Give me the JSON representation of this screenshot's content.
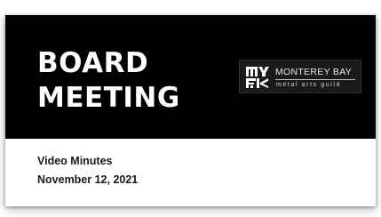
{
  "slide": {
    "title_line1": "BOARD",
    "title_line2": "MEETING",
    "subtitle_line1": "Video Minutes",
    "subtitle_line2": "November 12, 2021"
  },
  "logo": {
    "line1": "MONTEREY BAY",
    "line2": "metal arts guild",
    "icon": "mbmag-logo-icon"
  },
  "colors": {
    "banner": "#000000",
    "title_text": "#ffffff",
    "subtitle_text": "#1a1a1a",
    "background": "#ffffff"
  }
}
